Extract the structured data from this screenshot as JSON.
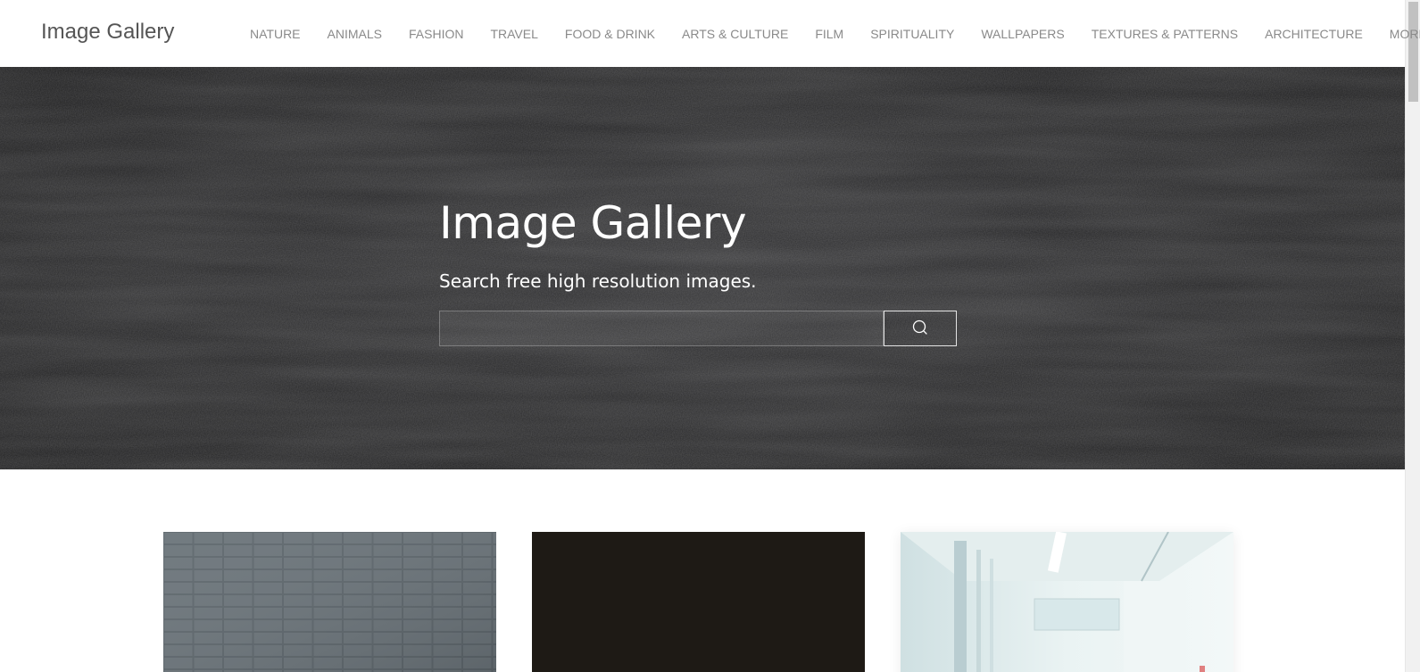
{
  "site": {
    "logo": "Image Gallery"
  },
  "nav": {
    "items": [
      {
        "label": "NATURE"
      },
      {
        "label": "ANIMALS"
      },
      {
        "label": "FASHION"
      },
      {
        "label": "TRAVEL"
      },
      {
        "label": "FOOD & DRINK"
      },
      {
        "label": "ARTS & CULTURE"
      },
      {
        "label": "FILM"
      },
      {
        "label": "SPIRITUALITY"
      },
      {
        "label": "WALLPAPERS"
      },
      {
        "label": "TEXTURES & PATTERNS"
      },
      {
        "label": "ARCHITECTURE"
      }
    ],
    "more_label": "MORE",
    "more_icon": "chevron-down-icon"
  },
  "hero": {
    "title": "Image Gallery",
    "subtitle": "Search free high resolution images.",
    "search": {
      "placeholder": "",
      "value": "",
      "button_icon": "search-icon"
    }
  },
  "gallery": {
    "cards": [
      {
        "subject": "gray tiled wall"
      },
      {
        "subject": "dark brown surface"
      },
      {
        "subject": "light teal interior"
      }
    ]
  },
  "colors": {
    "hero_bg": "#1c1c1e",
    "nav_text": "#8a8a8a",
    "logo_text": "#555555"
  }
}
